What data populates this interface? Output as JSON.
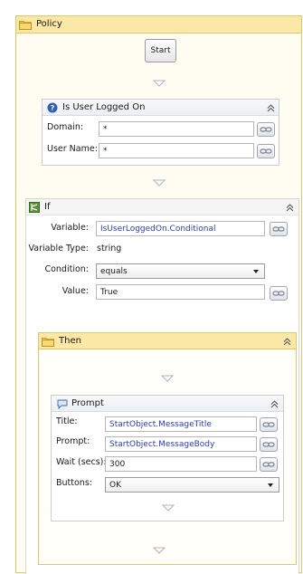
{
  "policy": {
    "title": "Policy"
  },
  "start": {
    "label": "Start"
  },
  "logged_on": {
    "title": "Is User Logged On",
    "domain_label": "Domain:",
    "domain_value": "*",
    "username_label": "User Name:",
    "username_value": "*"
  },
  "if": {
    "title": "If",
    "variable_label": "Variable:",
    "variable_value": "IsUserLoggedOn.Conditional",
    "variable_type_label": "Variable Type:",
    "variable_type_value": "string",
    "condition_label": "Condition:",
    "condition_value": "equals",
    "value_label": "Value:",
    "value_value": "True"
  },
  "then": {
    "title": "Then"
  },
  "prompt": {
    "title": "Prompt",
    "title_label": "Title:",
    "title_value": "StartObject.MessageTitle",
    "prompt_label": "Prompt:",
    "prompt_value": "StartObject.MessageBody",
    "wait_label": "Wait (secs):",
    "wait_value": "300",
    "buttons_label": "Buttons:",
    "buttons_value": "OK"
  },
  "colors": {
    "folder_header": "#fbe7a6",
    "folder_border": "#e3c56a",
    "bound_text": "#2a3fb4",
    "info_icon": "#2d5fb8"
  }
}
